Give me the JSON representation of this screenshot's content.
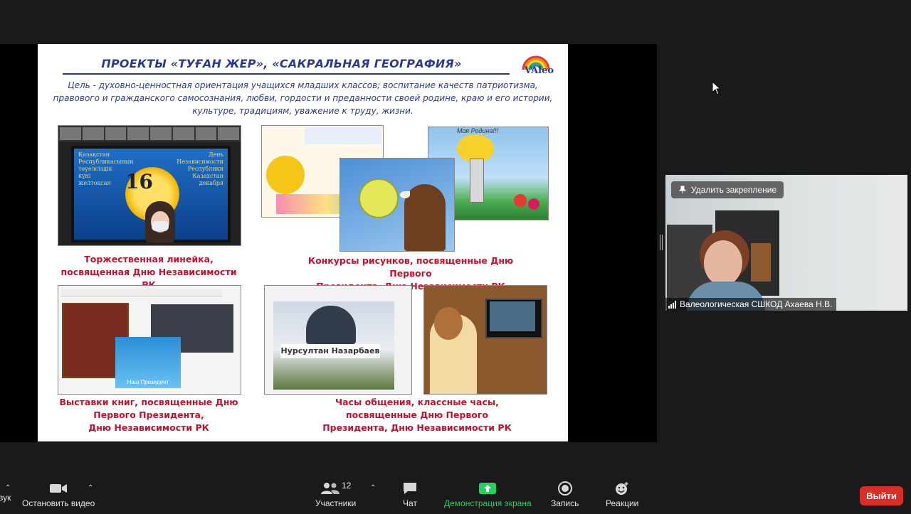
{
  "slide": {
    "title": "ПРОЕКТЫ «ТУҒАН ЖЕР», «САКРАЛЬНАЯ ГЕОГРАФИЯ»",
    "logo_text": "VAleo",
    "goal_lines": [
      "Цель - духовно-ценностная ориентация учащихся младших классов; воспитание качеств патриотизма,",
      "правового и гражданского самосознания, любви, гордости и преданности своей родине, краю и его истории,",
      "культуре, традициям, уважение к труду, жизни."
    ],
    "captions": {
      "c1": [
        "Торжественная линейка,",
        "посвященная Дню Независимости РК"
      ],
      "c2": [
        "Конкурсы рисунков, посвященные Дню Первого",
        "Президента, Дню Независимости РК"
      ],
      "c3": [
        "Выставки книг, посвященные Дню",
        "Первого Президента,",
        "Дню Независимости РК"
      ],
      "c4": [
        "Часы общения, классные часы,",
        "посвященные Дню Первого",
        "Президента, Дню Независимости РК"
      ]
    },
    "photo_texts": {
      "tv_number": "16",
      "tv_left": [
        "Қазақстан",
        "Республикасының",
        "тәуелсіздік",
        "күні",
        "желтоқсан"
      ],
      "tv_right": [
        "День",
        "Независимости",
        "Республики",
        "Казахстан",
        "декабря"
      ],
      "drawing_header": "Моя Родина!!!",
      "portrait_name": "Нурсултан Назарбаев",
      "book_caption": "Наш Президент"
    }
  },
  "video": {
    "unpin_label": "Удалить закрепление",
    "participant_name": "Валеологическая СШКОД Ахаева Н.В."
  },
  "toolbar": {
    "audio_label": "вук",
    "video_label": "Остановить видео",
    "participants_label": "Участники",
    "participants_count": "12",
    "chat_label": "Чат",
    "share_label": "Демонстрация экрана",
    "record_label": "Запись",
    "reactions_label": "Реакции",
    "leave_label": "Выйти",
    "share_color": "#23d160"
  }
}
